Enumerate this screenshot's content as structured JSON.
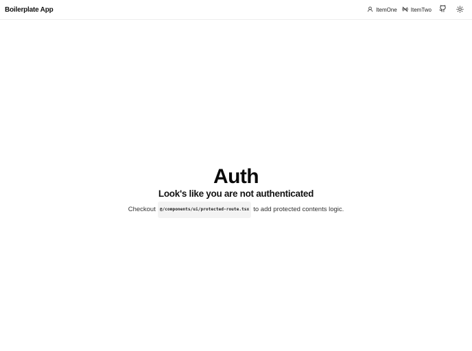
{
  "navbar": {
    "brand": "Boilerplate App",
    "links": [
      {
        "label": "ItemOne",
        "icon": "user-icon"
      },
      {
        "label": "ItemTwo",
        "icon": "broadcast-icon"
      }
    ],
    "github_icon": "github-icon",
    "theme_icon": "sun-icon"
  },
  "main": {
    "title": "Auth",
    "subtitle": "Look's like you are not authenticated",
    "desc_prefix": "Checkout",
    "code_path": "@/components/ui/protected-route.tsx",
    "desc_suffix": "to add protected contents logic."
  }
}
